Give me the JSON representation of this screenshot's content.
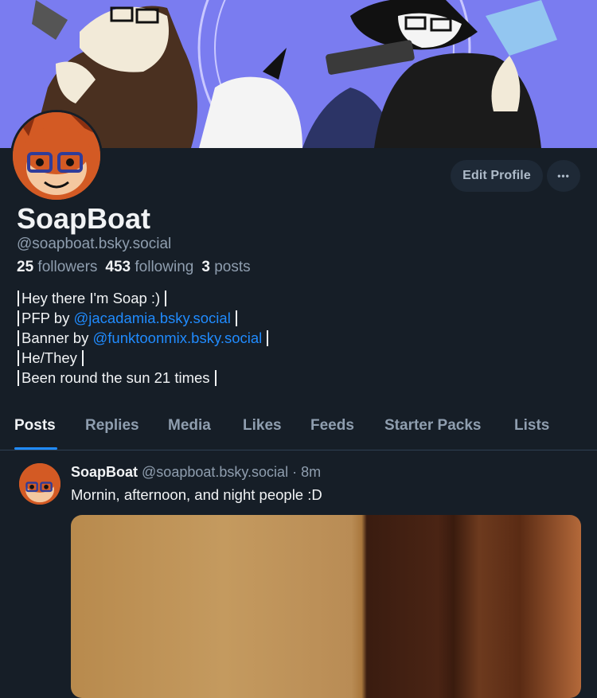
{
  "profile": {
    "display_name": "SoapBoat",
    "handle": "@soapboat.bsky.social",
    "edit_label": "Edit Profile",
    "more_label": "•••",
    "stats": {
      "followers_count": "25",
      "followers_label": "followers",
      "following_count": "453",
      "following_label": "following",
      "posts_count": "3",
      "posts_label": "posts"
    },
    "bio": {
      "line1": "Hey there I'm Soap :)",
      "line2_prefix": "PFP by ",
      "line2_link": "@jacadamia.bsky.social",
      "line3_prefix": "Banner by ",
      "line3_link": "@funktoonmix.bsky.social",
      "line4": "He/They",
      "line5": "Been round the sun 21 times"
    }
  },
  "tabs": [
    "Posts",
    "Replies",
    "Media",
    "Likes",
    "Feeds",
    "Starter Packs",
    "Lists"
  ],
  "post": {
    "author": "SoapBoat",
    "handle": "@soapboat.bsky.social",
    "separator": "·",
    "time": "8m",
    "text": "Mornin, afternoon, and night people :D"
  },
  "colors": {
    "background": "#161e27",
    "accent": "#208bfe",
    "muted": "#8f9eaf",
    "banner": "#7a7cf0"
  }
}
